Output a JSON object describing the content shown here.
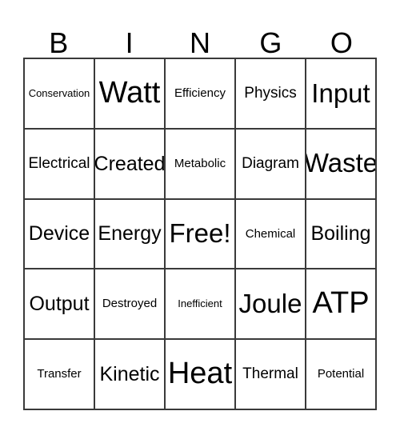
{
  "header": {
    "letters": [
      "B",
      "I",
      "N",
      "G",
      "O"
    ]
  },
  "grid": {
    "rows": [
      [
        {
          "label": "Conservation",
          "size": "fs-xxs"
        },
        {
          "label": "Watt",
          "size": "fs-xxl"
        },
        {
          "label": "Efficiency",
          "size": "fs-xs"
        },
        {
          "label": "Physics",
          "size": "fs-sm"
        },
        {
          "label": "Input",
          "size": "fs-xl"
        }
      ],
      [
        {
          "label": "Electrical",
          "size": "fs-sm"
        },
        {
          "label": "Created",
          "size": "fs-md"
        },
        {
          "label": "Metabolic",
          "size": "fs-xs"
        },
        {
          "label": "Diagram",
          "size": "fs-sm"
        },
        {
          "label": "Waste",
          "size": "fs-xl"
        }
      ],
      [
        {
          "label": "Device",
          "size": "fs-md"
        },
        {
          "label": "Energy",
          "size": "fs-md"
        },
        {
          "label": "Free!",
          "size": "fs-xl"
        },
        {
          "label": "Chemical",
          "size": "fs-xs"
        },
        {
          "label": "Boiling",
          "size": "fs-md"
        }
      ],
      [
        {
          "label": "Output",
          "size": "fs-md"
        },
        {
          "label": "Destroyed",
          "size": "fs-xs"
        },
        {
          "label": "Inefficient",
          "size": "fs-xxs"
        },
        {
          "label": "Joule",
          "size": "fs-xl"
        },
        {
          "label": "ATP",
          "size": "fs-xxl"
        }
      ],
      [
        {
          "label": "Transfer",
          "size": "fs-xs"
        },
        {
          "label": "Kinetic",
          "size": "fs-md"
        },
        {
          "label": "Heat",
          "size": "fs-xxl"
        },
        {
          "label": "Thermal",
          "size": "fs-sm"
        },
        {
          "label": "Potential",
          "size": "fs-xs"
        }
      ]
    ]
  },
  "style": {
    "background": "#ffffff",
    "text_color": "#000000",
    "border_color": "#3a3a3a"
  }
}
